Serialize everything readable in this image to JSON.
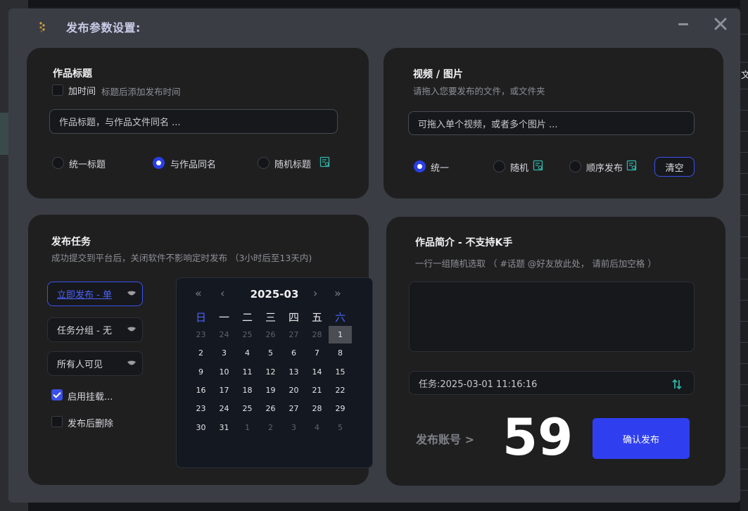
{
  "window": {
    "title": "发布参数设置:"
  },
  "title_card": {
    "heading": "作品标题",
    "add_time_label": "加时间",
    "add_time_hint": "标题后添加发布时间",
    "input_placeholder": "作品标题，与作品文件同名 ...",
    "options": [
      "统一标题",
      "与作品同名",
      "随机标题"
    ],
    "selected": "与作品同名"
  },
  "media_card": {
    "heading": "视频 / 图片",
    "hint": "请拖入您要发布的文件，或文件夹",
    "input_placeholder": "可拖入单个视频，或者多个图片 ...",
    "options": [
      "统一",
      "随机",
      "顺序发布"
    ],
    "selected": "统一",
    "clear_label": "清空"
  },
  "task_card": {
    "heading": "发布任务",
    "hint": "成功提交到平台后，关闭软件不影响定时发布 （3小时后至13天内)",
    "publish_mode": "立即发布 - 单",
    "task_group": "任务分组 - 无",
    "visibility": "所有人可见",
    "enable_mount_label": "启用挂载...",
    "enable_mount_checked": true,
    "delete_after_label": "发布后删除",
    "delete_after_checked": false,
    "calendar": {
      "prev_year": "«",
      "prev_month": "‹",
      "month_label": "2025-03",
      "next_month": "›",
      "next_year": "»",
      "weekdays": [
        "日",
        "一",
        "二",
        "三",
        "四",
        "五",
        "六"
      ],
      "weeks": [
        [
          "23",
          "24",
          "25",
          "26",
          "27",
          "28",
          "1"
        ],
        [
          "2",
          "3",
          "4",
          "5",
          "6",
          "7",
          "8"
        ],
        [
          "9",
          "10",
          "11",
          "12",
          "13",
          "14",
          "15"
        ],
        [
          "16",
          "17",
          "18",
          "19",
          "20",
          "21",
          "22"
        ],
        [
          "23",
          "24",
          "25",
          "26",
          "27",
          "28",
          "29"
        ],
        [
          "30",
          "31",
          "1",
          "2",
          "3",
          "4",
          "5"
        ]
      ],
      "selected_day": "1"
    }
  },
  "desc_card": {
    "heading": "作品简介  -  不支持K手",
    "hint": "一行一组随机选取    （ #话题  @好友放此处， 请前后加空格 ）",
    "description_value": "",
    "task_time": "任务:2025-03-01 11:16:16",
    "account_link": "发布账号 >",
    "account_count": "59",
    "confirm_label": "确认发布"
  },
  "background": {
    "right_glyph": "文"
  },
  "colors": {
    "accent": "#2f3ff0",
    "teal_icon": "#2fb5a8",
    "card_bg": "#1f1f20",
    "dialog_bg": "#3a3d44"
  }
}
